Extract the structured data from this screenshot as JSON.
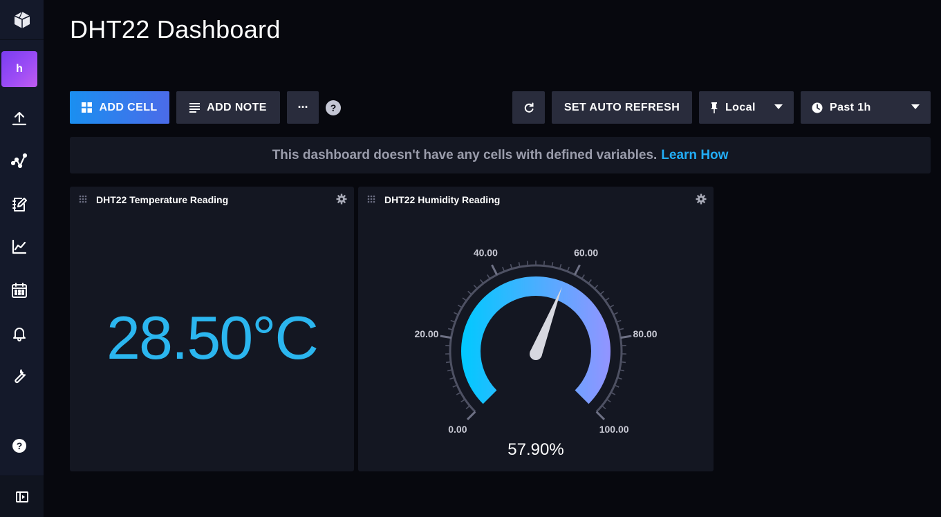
{
  "page": {
    "title": "DHT22 Dashboard"
  },
  "sidebar": {
    "org_letter": "h",
    "items": [
      {
        "icon": "upload-icon"
      },
      {
        "icon": "data-explorer-icon"
      },
      {
        "icon": "notebook-icon"
      },
      {
        "icon": "dashboards-icon"
      },
      {
        "icon": "calendar-icon"
      },
      {
        "icon": "bell-icon"
      },
      {
        "icon": "wrench-icon"
      }
    ],
    "help_icon": "help-icon",
    "collapse_icon": "collapse-icon"
  },
  "toolbar": {
    "add_cell": "ADD CELL",
    "add_note": "ADD NOTE",
    "more": "···",
    "help": "?",
    "auto_refresh": "SET AUTO REFRESH",
    "timezone": "Local",
    "time_range": "Past 1h"
  },
  "notice": {
    "text": "This dashboard doesn't have any cells with defined variables.",
    "link": "Learn How"
  },
  "cells": {
    "temperature": {
      "title": "DHT22 Temperature Reading",
      "value": "28.50°C",
      "color": "#2bb6ef"
    },
    "humidity": {
      "title": "DHT22 Humidity Reading",
      "value": "57.90%",
      "gauge": {
        "min": 0,
        "max": 100,
        "value": 57.9,
        "labels": [
          "0.00",
          "20.00",
          "40.00",
          "60.00",
          "80.00",
          "100.00"
        ],
        "color_start": "#00c9ff",
        "color_end": "#9394ff"
      }
    }
  },
  "colors": {
    "background": "#07080e",
    "sidebar": "#14192a",
    "panel": "#141722",
    "button": "#292c3c",
    "accent": "#22adf6"
  }
}
